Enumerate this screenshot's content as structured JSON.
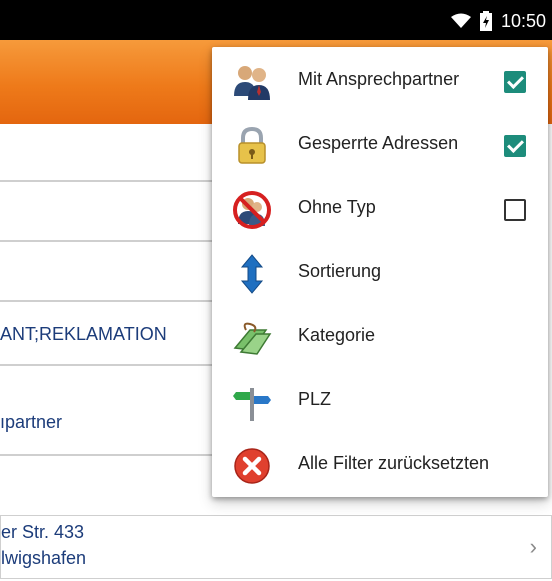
{
  "status_bar": {
    "time": "10:50",
    "wifi_icon": "wifi-icon",
    "battery_icon": "battery-charging-icon"
  },
  "background_list": {
    "rows": [
      {
        "text": ""
      },
      {
        "text": ""
      },
      {
        "text": ""
      },
      {
        "text": "ANT;REKLAMATION"
      },
      {
        "text": "ıpartner"
      },
      {
        "text": ""
      }
    ],
    "card": {
      "line1": "er Str. 433",
      "line2": "lwigshafen"
    }
  },
  "filter_menu": {
    "items": [
      {
        "label": "Mit Ansprechpartner",
        "icon": "contact-persons-icon",
        "checkbox": true,
        "checked": true
      },
      {
        "label": "Gesperrte Adressen",
        "icon": "lock-icon",
        "checkbox": true,
        "checked": true
      },
      {
        "label": "Ohne Typ",
        "icon": "no-type-icon",
        "checkbox": true,
        "checked": false
      },
      {
        "label": "Sortierung",
        "icon": "sort-arrows-icon",
        "checkbox": false
      },
      {
        "label": "Kategorie",
        "icon": "category-tag-icon",
        "checkbox": false
      },
      {
        "label": "PLZ",
        "icon": "signpost-icon",
        "checkbox": false
      },
      {
        "label": "Alle Filter zurücksetzten",
        "icon": "reset-filter-icon",
        "checkbox": false
      }
    ]
  },
  "colors": {
    "toolbar_orange": "#ee7a1a",
    "checkbox_teal": "#1d8c7b",
    "list_text_blue": "#1c3c7a"
  }
}
